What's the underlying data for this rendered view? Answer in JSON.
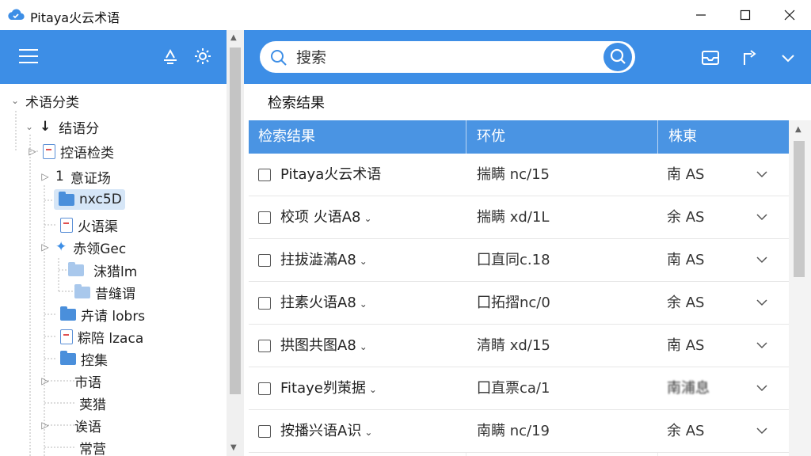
{
  "window": {
    "title": "Pitaya火云术语",
    "controls": [
      "minimize",
      "maximize",
      "close"
    ]
  },
  "left_header": {
    "icons": [
      "menu-icon",
      "export-icon",
      "settings-icon"
    ]
  },
  "tree": {
    "items": [
      {
        "label": "术语分类",
        "icon": "none",
        "expander": "expanded"
      },
      {
        "label": "结语分",
        "icon": "sort-icon",
        "expander": "expanded"
      },
      {
        "label": "控语检类",
        "icon": "doc-icon",
        "expander": "collapsed"
      },
      {
        "label": "意证场",
        "icon": "sort-icon",
        "expander": "collapsed"
      },
      {
        "label": "nxc5D",
        "icon": "folder-icon",
        "expander": "none",
        "selected": true
      },
      {
        "label": "火语渠",
        "icon": "doc-icon",
        "expander": "none"
      },
      {
        "label": "赤领Gec",
        "icon": "star-icon",
        "expander": "collapsed"
      },
      {
        "label": "沫猎lm",
        "icon": "folder-light-icon",
        "expander": "none"
      },
      {
        "label": "昔缝谓",
        "icon": "folder-light-icon",
        "expander": "none"
      },
      {
        "label": "卉请 lobrs",
        "icon": "folder-icon",
        "expander": "none"
      },
      {
        "label": "粽陪 lzaca",
        "icon": "doc-icon",
        "expander": "none"
      },
      {
        "label": "控集",
        "icon": "folder-icon",
        "expander": "none"
      },
      {
        "label": "市语",
        "icon": "none",
        "expander": "collapsed"
      },
      {
        "label": "荚猎",
        "icon": "none",
        "expander": "none"
      },
      {
        "label": "诶语",
        "icon": "none",
        "expander": "collapsed"
      },
      {
        "label": "常营",
        "icon": "none",
        "expander": "none"
      }
    ]
  },
  "search": {
    "placeholder": "搜索"
  },
  "right_header": {
    "icons": [
      "inbox-icon",
      "share-icon",
      "chevron-down-icon"
    ]
  },
  "content": {
    "section_title": "检索结果",
    "columns": [
      "检索结果",
      "环优",
      "株東"
    ],
    "rows": [
      {
        "term": "Pitaya火云术语",
        "term_chevron": false,
        "col2": "揣瞒 nc/15",
        "col3": "南 AS"
      },
      {
        "term": "校项 火语A8",
        "term_chevron": true,
        "col2": "揣瞒 xd/1L",
        "col3": "余 AS"
      },
      {
        "term": "拄拔澁滿A8",
        "term_chevron": true,
        "col2": "囗直同c.18",
        "col3": "南 AS"
      },
      {
        "term": "拄素火语A8",
        "term_chevron": true,
        "col2": "囗拓摺nc/0",
        "col3": "余 AS"
      },
      {
        "term": "拱图共图A8",
        "term_chevron": true,
        "col2": "清睛 xd/15",
        "col3": "南 AS"
      },
      {
        "term": "Fitaye刿茦据",
        "term_chevron": true,
        "col2": "囗直票ca/1",
        "col3": "南浦息"
      },
      {
        "term": "按播兴语A识",
        "term_chevron": true,
        "col2": "南瞒 nc/19",
        "col3": "余 AS"
      }
    ]
  },
  "colors": {
    "accent": "#3d8ee6",
    "table_header": "#4a94e3",
    "selected": "#d6e6f7"
  }
}
